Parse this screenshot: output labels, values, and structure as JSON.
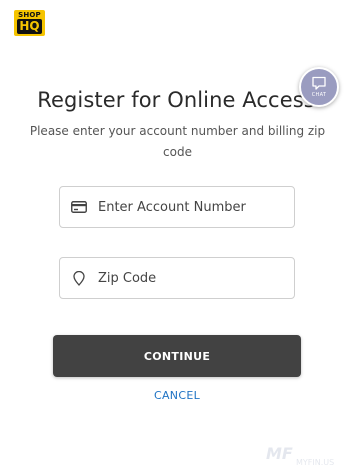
{
  "logo": {
    "top_text": "SHOP",
    "bottom_text": "HQ"
  },
  "header": {
    "title": "Register for Online Access",
    "subtitle": "Please enter your account number and billing zip code"
  },
  "chat": {
    "label": "CHAT",
    "icon": "chat-bubble-icon"
  },
  "form": {
    "account_number": {
      "placeholder": "Enter Account Number",
      "value": "",
      "icon": "credit-card-icon"
    },
    "zip_code": {
      "placeholder": "Zip Code",
      "value": "",
      "icon": "location-pin-icon"
    }
  },
  "actions": {
    "continue_label": "CONTINUE",
    "cancel_label": "CANCEL"
  },
  "watermark": {
    "mark": "MF",
    "text": "MYFIN.US"
  },
  "colors": {
    "brand_yellow": "#f5c400",
    "button_dark": "#424242",
    "link_blue": "#1f73c4",
    "chat_purple": "#9a9cc0"
  }
}
